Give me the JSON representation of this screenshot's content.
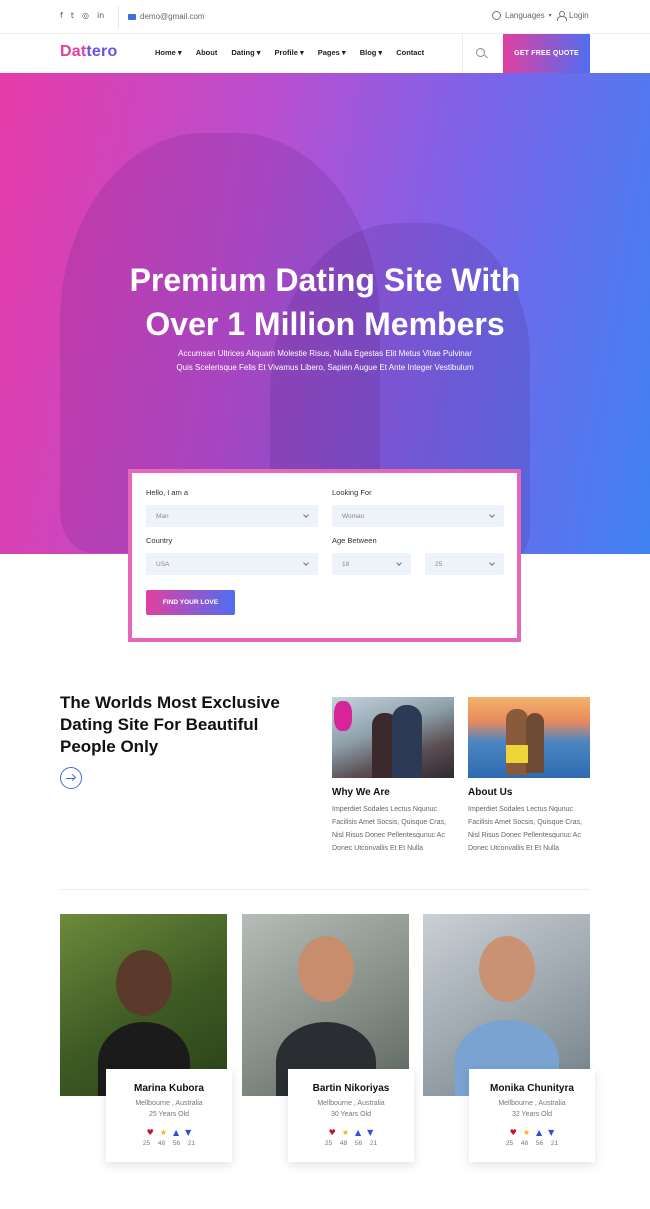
{
  "topbar": {
    "social": [
      {
        "icon": "facebook-icon",
        "glyph": "f"
      },
      {
        "icon": "twitter-icon",
        "glyph": "t"
      },
      {
        "icon": "instagram-icon",
        "glyph": "◎"
      },
      {
        "icon": "linkedin-icon",
        "glyph": "in"
      }
    ],
    "email": "demo@gmail.com",
    "languages_label": "Languages",
    "login_label": "Login"
  },
  "navbar": {
    "logo_part1": "Dat",
    "logo_part2": "tero",
    "items": [
      {
        "label": "Home ▾"
      },
      {
        "label": "About"
      },
      {
        "label": "Dating ▾"
      },
      {
        "label": "Profile ▾"
      },
      {
        "label": "Pages ▾"
      },
      {
        "label": "Blog ▾"
      },
      {
        "label": "Contact"
      }
    ],
    "quote_button": "GET FREE QUOTE"
  },
  "hero": {
    "title_line1": "Premium Dating Site With",
    "title_line2": "Over 1 Million Members",
    "subtitle_line1": "Accumsan Ultrices Aliquam Molestie Risus, Nulla Egestas Elit Metus Vitae Pulvinar",
    "subtitle_line2": "Quis Scelerisque Felis Et Vivamus Libero, Sapien Augue Et Ante Integer Vestibulum"
  },
  "search_form": {
    "i_am_label": "Hello, I am a",
    "i_am_value": "Man",
    "looking_for_label": "Looking For",
    "looking_for_value": "Woman",
    "country_label": "Country",
    "country_value": "USA",
    "age_label": "Age Between",
    "age_min": "18",
    "age_max": "25",
    "submit_label": "FIND YOUR LOVE"
  },
  "about": {
    "title": "The Worlds Most Exclusive Dating Site For Beautiful People Only",
    "cards": [
      {
        "title": "Why We Are",
        "text": "Imperdiet Sodales Lectus Nqunuc Facilisis Amet Socsis, Quisque Cras, Nisl Risus Donec Pellentesqunuc Ac Donec Utconvallis Et Et Nulla"
      },
      {
        "title": "About Us",
        "text": "Imperdiet Sodales Lectus Nqunuc Facilisis Amet Socsis, Quisque Cras, Nisl Risus Donec Pellentesqunuc Ac Donec Utconvallis Et Et Nulla"
      }
    ]
  },
  "profiles": [
    {
      "name": "Marina Kubora",
      "location": "Mellbourne , Australia",
      "age": "25 Years Old",
      "counts": [
        "25",
        "48",
        "56",
        "21"
      ]
    },
    {
      "name": "Bartin Nikoriyas",
      "location": "Mellbourne , Australia",
      "age": "30 Years Old",
      "counts": [
        "25",
        "48",
        "56",
        "21"
      ]
    },
    {
      "name": "Monika Chunityra",
      "location": "Mellbourne , Australia",
      "age": "32 Years Old",
      "counts": [
        "25",
        "48",
        "56",
        "21"
      ]
    }
  ],
  "colors": {
    "brand_pink": "#e23fa0",
    "brand_blue": "#4f6ef0",
    "form_border": "#e467b8"
  }
}
